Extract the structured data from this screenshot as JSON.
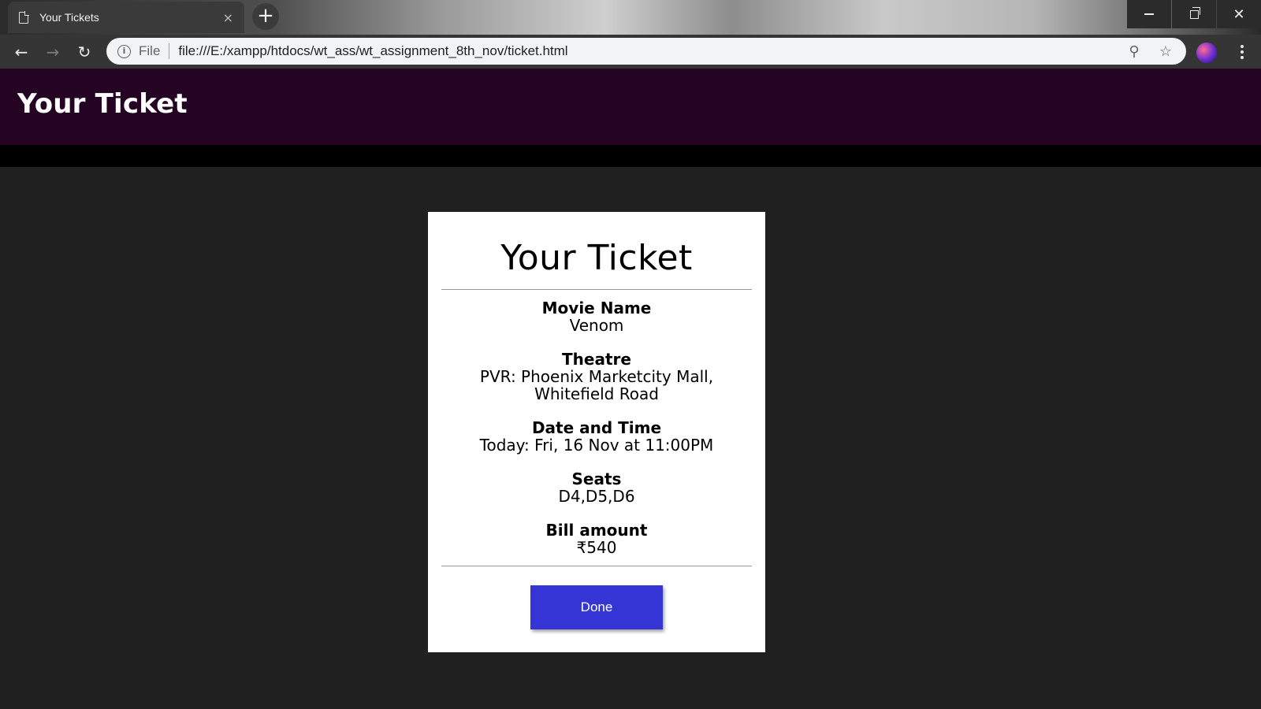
{
  "browser": {
    "tab_title": "Your Tickets",
    "tab_close": "×",
    "new_tab": "+",
    "url_scheme": "File",
    "url": "file:///E:/xampp/htdocs/wt_ass/wt_assignment_8th_nov/ticket.html",
    "window_controls": {
      "minimize": "",
      "maximize": "",
      "close": "✕"
    }
  },
  "header": {
    "title": "Your Ticket"
  },
  "ticket": {
    "title": "Your Ticket",
    "fields": [
      {
        "label": "Movie Name",
        "value": "Venom"
      },
      {
        "label": "Theatre",
        "value": "PVR: Phoenix Marketcity Mall, Whitefield Road"
      },
      {
        "label": "Date and Time",
        "value": "Today: Fri, 16 Nov at 11:00PM"
      },
      {
        "label": "Seats",
        "value": "D4,D5,D6"
      },
      {
        "label": "Bill amount",
        "value": "₹540"
      }
    ],
    "done_label": "Done"
  },
  "colors": {
    "header_bg": "#250322",
    "page_bg": "#212021",
    "button_bg": "#3535d6"
  }
}
